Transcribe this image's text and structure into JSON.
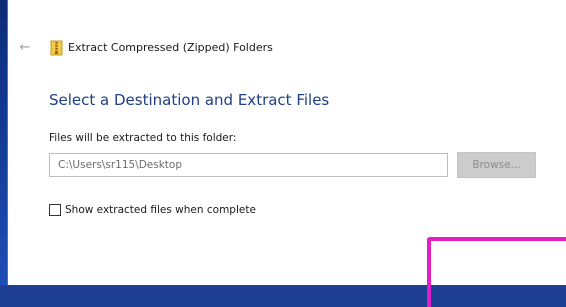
{
  "window": {
    "title": "Extract Compressed (Zipped) Folders",
    "back_icon": "back-arrow-icon",
    "app_icon": "zip-folder-icon"
  },
  "content": {
    "heading": "Select a Destination and Extract Files",
    "destination_label": "Files will be extracted to this folder:",
    "destination_value": "C:\\Users\\sr115\\Desktop",
    "browse_label": "Browse...",
    "show_files_label": "Show extracted files when complete",
    "show_files_checked": false
  },
  "colors": {
    "heading": "#1f3f86",
    "annotation": "#e21fc7",
    "background": "#1f3f95"
  }
}
